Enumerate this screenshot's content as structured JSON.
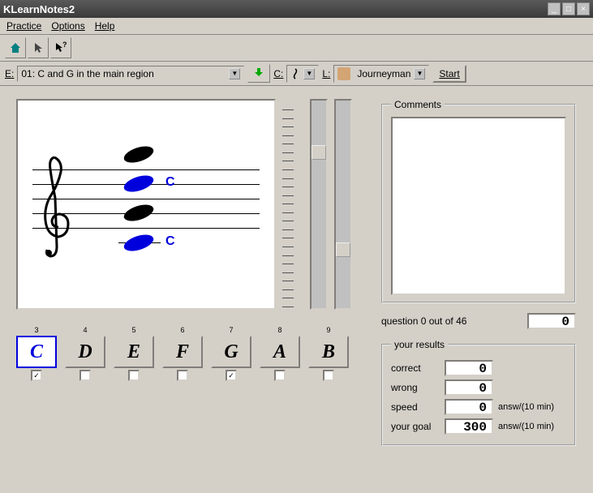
{
  "title": "KLearnNotes2",
  "menu": {
    "practice": "Practice",
    "options": "Options",
    "help": "Help"
  },
  "config": {
    "e_label": "E:",
    "exercise": "01: C and G in the main region",
    "c_label": "C:",
    "l_label": "L:",
    "user": "Journeyman",
    "start": "Start"
  },
  "notes": [
    {
      "n": "3",
      "l": "C",
      "sel": true,
      "chk": true
    },
    {
      "n": "4",
      "l": "D",
      "sel": false,
      "chk": false
    },
    {
      "n": "5",
      "l": "E",
      "sel": false,
      "chk": false
    },
    {
      "n": "6",
      "l": "F",
      "sel": false,
      "chk": false
    },
    {
      "n": "7",
      "l": "G",
      "sel": false,
      "chk": true
    },
    {
      "n": "8",
      "l": "A",
      "sel": false,
      "chk": false
    },
    {
      "n": "9",
      "l": "B",
      "sel": false,
      "chk": false
    }
  ],
  "staff": {
    "note_labels": [
      "C",
      "C"
    ]
  },
  "comments": {
    "legend": "Comments"
  },
  "question": {
    "text": "question 0 out of 46",
    "counter": "0"
  },
  "results": {
    "legend": "your results",
    "correct_l": "correct",
    "correct_v": "0",
    "wrong_l": "wrong",
    "wrong_v": "0",
    "speed_l": "speed",
    "speed_v": "0",
    "speed_u": "answ/(10 min)",
    "goal_l": "your goal",
    "goal_v": "300",
    "goal_u": "answ/(10 min)"
  }
}
